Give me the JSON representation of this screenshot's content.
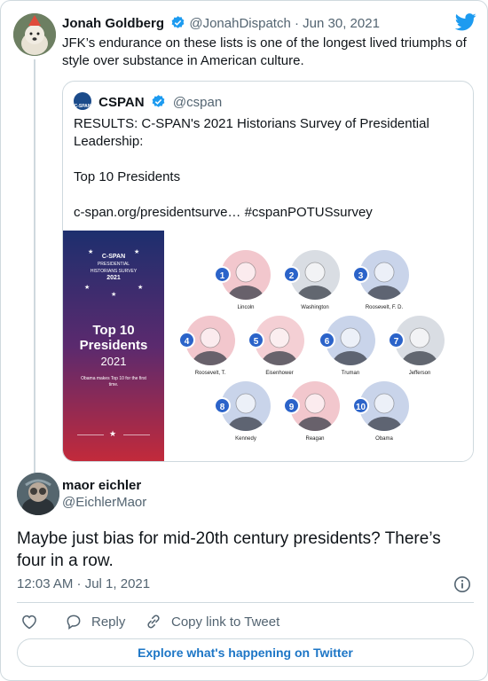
{
  "parent": {
    "name": "Jonah Goldberg",
    "handle": "@JonahDispatch",
    "separator": "·",
    "date": "Jun 30, 2021",
    "text": "JFK’s endurance on these lists is one of the longest lived triumphs of style over substance in American culture."
  },
  "quote": {
    "name": "CSPAN",
    "handle": "@cspan",
    "avatar_text": "C-SPAN",
    "text": "RESULTS: C-SPAN's 2021 Historians Survey of Presidential Leadership:\n\nTop 10 Presidents\n\nc-span.org/presidentsurve… #cspanPOTUSsurvey",
    "image": {
      "logo_line1": "C-SPAN",
      "logo_line2": "PRESIDENTIAL",
      "logo_line3": "HISTORIANS SURVEY",
      "logo_line4": "2021",
      "title_line1": "Top 10",
      "title_line2": "Presidents",
      "year": "2021",
      "note": "Obama makes Top 10 for the first time.",
      "presidents": [
        {
          "rank": "1",
          "name": "Lincoln",
          "color": "#f2c7cd"
        },
        {
          "rank": "2",
          "name": "Washington",
          "color": "#d9dde3"
        },
        {
          "rank": "3",
          "name": "Roosevelt, F. D.",
          "color": "#c9d4ea"
        },
        {
          "rank": "4",
          "name": "Roosevelt, T.",
          "color": "#f2c7cd"
        },
        {
          "rank": "5",
          "name": "Eisenhower",
          "color": "#f4cfd4"
        },
        {
          "rank": "6",
          "name": "Truman",
          "color": "#c9d4ea"
        },
        {
          "rank": "7",
          "name": "Jefferson",
          "color": "#d9dde3"
        },
        {
          "rank": "8",
          "name": "Kennedy",
          "color": "#c9d4ea"
        },
        {
          "rank": "9",
          "name": "Reagan",
          "color": "#f2c7cd"
        },
        {
          "rank": "10",
          "name": "Obama",
          "color": "#c9d4ea"
        }
      ]
    }
  },
  "reply": {
    "name": "maor eichler",
    "handle": "@EichlerMaor",
    "text": "Maybe just bias for mid-20th century presidents? There’s four in a row.",
    "time": "12:03 AM · Jul 1, 2021"
  },
  "actions": {
    "reply_label": "Reply",
    "copy_label": "Copy link to Tweet"
  },
  "explore_label": "Explore what's happening on Twitter",
  "colors": {
    "twitter_blue": "#1d9bf0",
    "badge_blue": "#2b63c9",
    "red": "#c42a3a",
    "navy": "#1d2f6e"
  }
}
